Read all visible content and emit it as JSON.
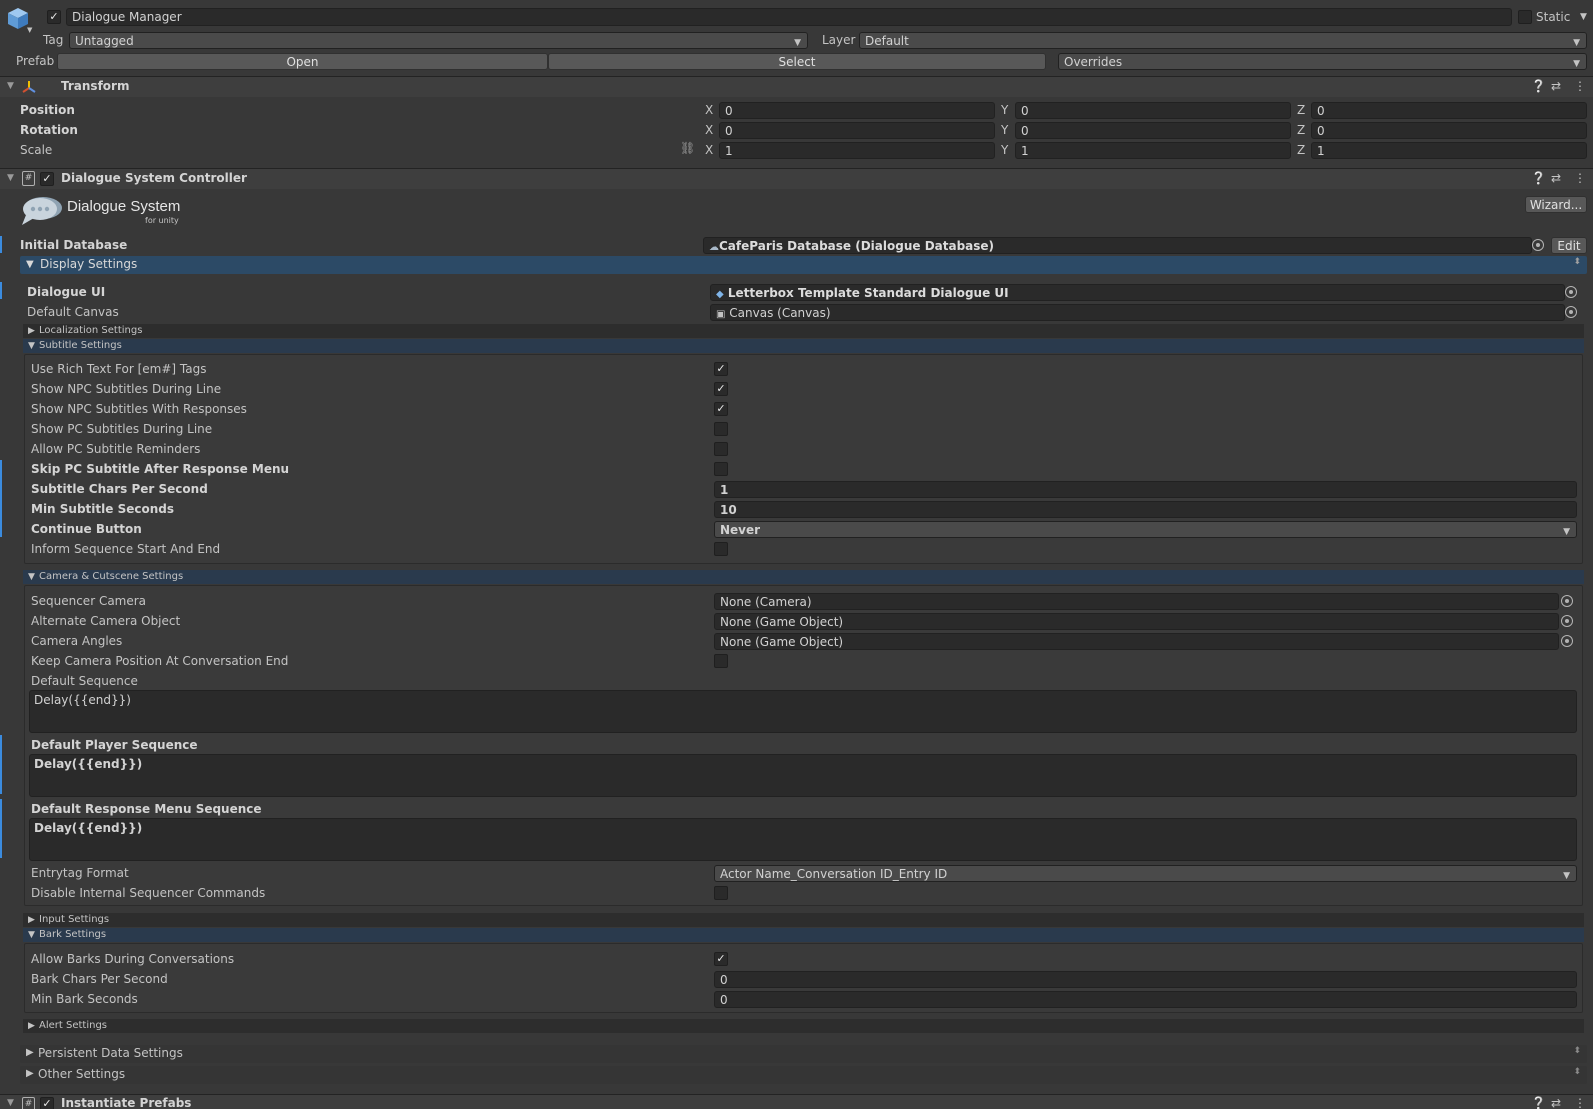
{
  "object": {
    "name": "Dialogue Manager",
    "static_label": "Static",
    "tag_label": "Tag",
    "tag_value": "Untagged",
    "layer_label": "Layer",
    "layer_value": "Default",
    "prefab_label": "Prefab",
    "open_label": "Open",
    "select_label": "Select",
    "overrides_label": "Overrides"
  },
  "transform": {
    "title": "Transform",
    "rows": [
      {
        "label": "Position",
        "x": "0",
        "y": "0",
        "z": "0"
      },
      {
        "label": "Rotation",
        "x": "0",
        "y": "0",
        "z": "0"
      },
      {
        "label": "Scale",
        "x": "1",
        "y": "1",
        "z": "1"
      }
    ],
    "axis_x": "X",
    "axis_y": "Y",
    "axis_z": "Z"
  },
  "controller": {
    "title": "Dialogue System Controller",
    "logo_main": "Dialogue System",
    "logo_sub": "for unity",
    "wizard_label": "Wizard...",
    "initial_db_label": "Initial Database",
    "initial_db_value": "CafeParis Database (Dialogue Database)",
    "edit_label": "Edit",
    "display_settings": "Display Settings",
    "dialogue_ui_label": "Dialogue UI",
    "dialogue_ui_value": "Letterbox Template Standard Dialogue UI",
    "default_canvas_label": "Default Canvas",
    "default_canvas_value": "Canvas (Canvas)",
    "localization_settings": "Localization Settings",
    "subtitle_settings": "Subtitle Settings",
    "subtitle": {
      "rich_text": "Use Rich Text For [em#] Tags",
      "npc_during_line": "Show NPC Subtitles During Line",
      "npc_with_responses": "Show NPC Subtitles With Responses",
      "pc_during_line": "Show PC Subtitles During Line",
      "pc_reminders": "Allow PC Subtitle Reminders",
      "skip_pc": "Skip PC Subtitle After Response Menu",
      "chars_per_second_label": "Subtitle Chars Per Second",
      "chars_per_second_value": "1",
      "min_seconds_label": "Min Subtitle Seconds",
      "min_seconds_value": "10",
      "continue_label": "Continue Button",
      "continue_value": "Never",
      "inform_label": "Inform Sequence Start And End"
    },
    "camera_settings": "Camera & Cutscene Settings",
    "camera": {
      "sequencer_label": "Sequencer Camera",
      "sequencer_value": "None (Camera)",
      "alternate_label": "Alternate Camera Object",
      "alternate_value": "None (Game Object)",
      "angles_label": "Camera Angles",
      "angles_value": "None (Game Object)",
      "keep_label": "Keep Camera Position At Conversation End",
      "default_seq_label": "Default Sequence",
      "default_seq_value": "Delay({{end}})",
      "player_seq_label": "Default Player Sequence",
      "player_seq_value": "Delay({{end}})",
      "response_seq_label": "Default Response Menu Sequence",
      "response_seq_value": "Delay({{end}})",
      "entrytag_label": "Entrytag Format",
      "entrytag_value": "Actor Name_Conversation ID_Entry ID",
      "disable_internal_label": "Disable Internal Sequencer Commands"
    },
    "input_settings": "Input Settings",
    "bark_settings": "Bark Settings",
    "bark": {
      "allow_label": "Allow Barks During Conversations",
      "chars_label": "Bark Chars Per Second",
      "chars_value": "0",
      "min_label": "Min Bark Seconds",
      "min_value": "0"
    },
    "alert_settings": "Alert Settings",
    "persistent_settings": "Persistent Data Settings",
    "other_settings": "Other Settings"
  },
  "instantiate": {
    "title": "Instantiate Prefabs"
  },
  "colors": {
    "background": "#383838",
    "field": "#2a2a2a",
    "accent": "#3b8bde",
    "section_blue": "#2a3a4d"
  }
}
